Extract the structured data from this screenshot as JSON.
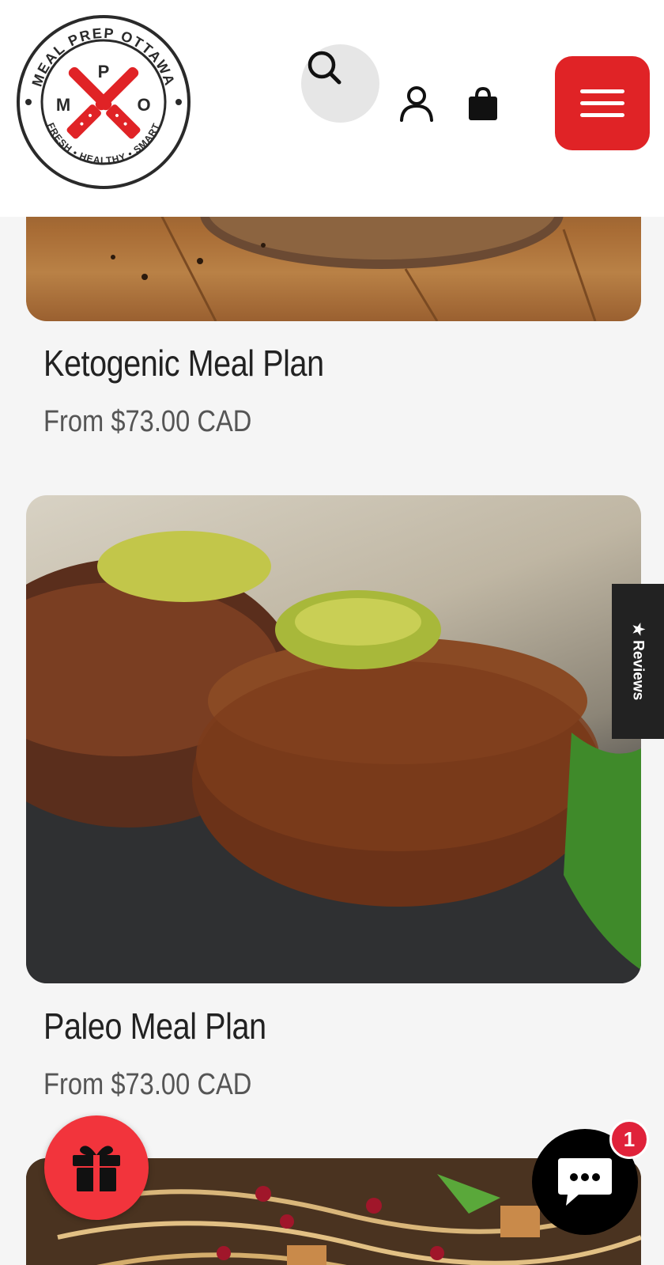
{
  "header": {
    "logo": {
      "top_text": "MEAL PREP OTTAWA",
      "bottom_text": "FRESH • HEALTHY • SMART",
      "letters": [
        "M",
        "P",
        "O"
      ]
    },
    "icons": [
      "search-icon",
      "account-icon",
      "shopping-bag-icon",
      "menu-icon"
    ]
  },
  "products": [
    {
      "title": "Ketogenic Meal Plan",
      "price": "From $73.00 CAD",
      "image": "grilled chicken on cutting board"
    },
    {
      "title": "Paleo Meal Plan",
      "price": "From $73.00 CAD",
      "image": "filet steaks with herb butter on slate"
    },
    {
      "title": "",
      "price": "",
      "image": "noodles with pomegranate and tofu"
    }
  ],
  "reviews_tab": {
    "label": "★ Reviews"
  },
  "chat": {
    "badge_count": "1"
  },
  "colors": {
    "brand_red": "#e02326",
    "header_bg": "#ffffff",
    "page_bg": "#f5f5f5",
    "text_dark": "#222222",
    "text_price": "#555555"
  }
}
